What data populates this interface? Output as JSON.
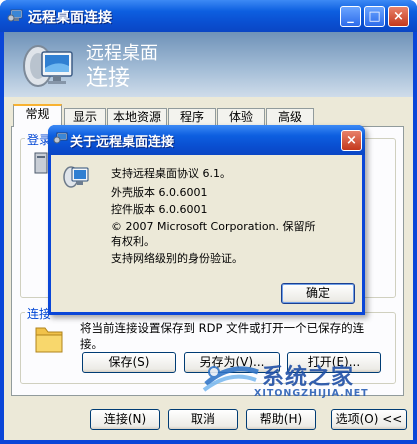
{
  "window": {
    "title": "远程桌面连接"
  },
  "banner": {
    "line1": "远程桌面",
    "line2": "连接"
  },
  "tabs": [
    {
      "label": "常规"
    },
    {
      "label": "显示"
    },
    {
      "label": "本地资源"
    },
    {
      "label": "程序"
    },
    {
      "label": "体验"
    },
    {
      "label": "高级"
    }
  ],
  "groups": {
    "login_label": "登录",
    "conn_label": "连接",
    "conn_desc": "将当前连接设置保存到 RDP 文件或打开一个已保存的连接。"
  },
  "buttons": {
    "save": "保存(S)",
    "save_as": "另存为(V)...",
    "open": "打开(E)...",
    "connect": "连接(N)",
    "cancel": "取消",
    "help": "帮助(H)",
    "options": "选项(O) <<"
  },
  "about": {
    "title": "关于远程桌面连接",
    "line1": "支持远程桌面协议 6.1。",
    "shell_version": "外壳版本 6.0.6001",
    "control_version": "控件版本 6.0.6001",
    "copyright": "© 2007 Microsoft Corporation. 保留所有权利。",
    "nla": "支持网络级别的身份验证。",
    "ok": "确定"
  },
  "watermark": {
    "text": "系统之家",
    "url": "XITONGZHIJIA.NET"
  }
}
